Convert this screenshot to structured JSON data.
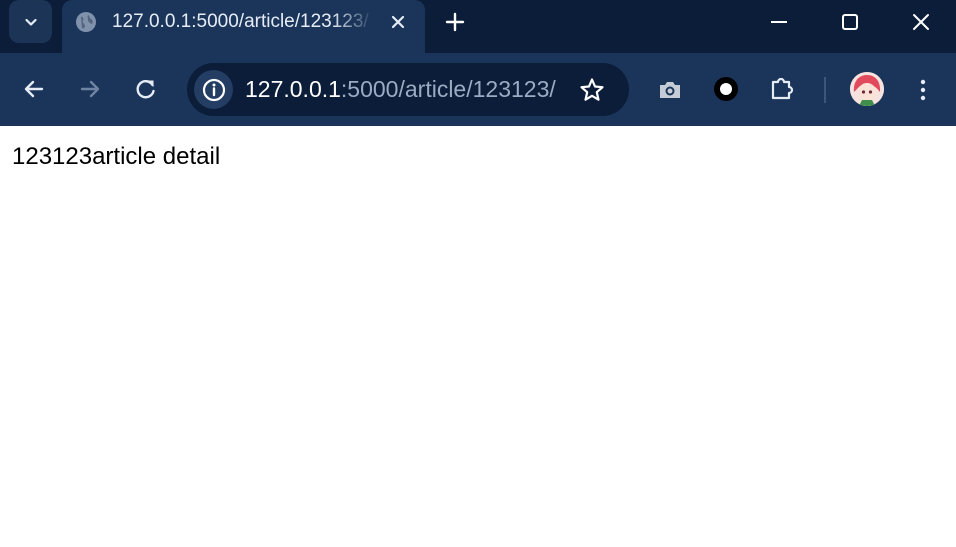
{
  "browser": {
    "tab": {
      "title": "127.0.0.1:5000/article/123123/"
    },
    "address_bar": {
      "host": "127.0.0.1",
      "path": ":5000/article/123123/"
    }
  },
  "page": {
    "heading": "123123article detail"
  },
  "colors": {
    "tabstrip_bg": "#0b1d38",
    "toolbar_bg": "#1a3559",
    "omnibox_bg": "#0b1d38",
    "page_bg": "#ffffff",
    "url_host": "#ffffff",
    "url_path": "#9aabc4"
  },
  "icons": {
    "tab_search": "chevron-down-icon",
    "favicon": "globe-icon",
    "tab_close": "close-icon",
    "new_tab": "plus-icon",
    "minimize": "minimize-icon",
    "maximize": "maximize-icon",
    "close_window": "close-icon",
    "back": "arrow-left-icon",
    "forward": "arrow-right-icon",
    "reload": "reload-icon",
    "site_info": "info-icon",
    "bookmark": "star-icon",
    "screenshot": "camera-icon",
    "extension_ring": "ring-icon",
    "extensions": "puzzle-icon",
    "profile": "avatar",
    "menu": "more-vertical-icon"
  }
}
